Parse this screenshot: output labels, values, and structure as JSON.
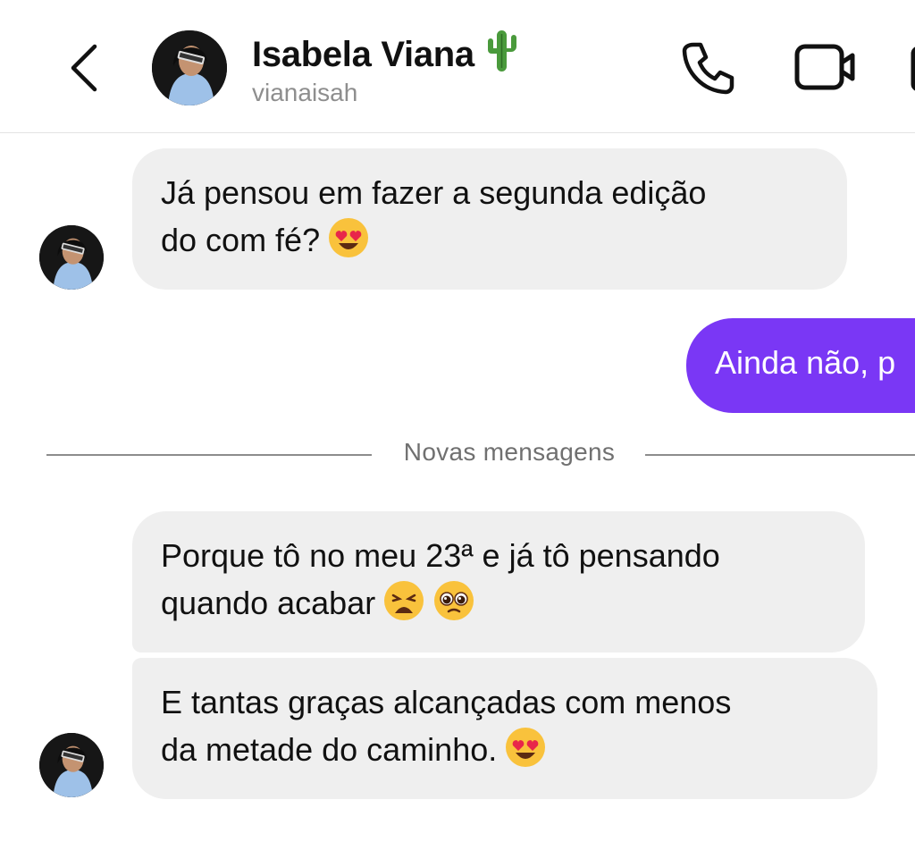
{
  "header": {
    "contact_name": "Isabela Viana",
    "username": "vianaisah",
    "name_emoji": "cactus-icon",
    "back_icon": "chevron-left-icon",
    "call_icon": "phone-icon",
    "video_icon": "video-camera-icon"
  },
  "messages": [
    {
      "direction": "incoming",
      "line1": "Já pensou em fazer a segunda edição",
      "line2": "do com fé?",
      "emoji": [
        "heart-eyes-emoji"
      ]
    },
    {
      "direction": "outgoing",
      "text": "Ainda não, p"
    },
    {
      "direction": "incoming",
      "line1": "Porque tô no meu 23ª e já tô pensando",
      "line2": "quando acabar",
      "emoji": [
        "weary-face-emoji",
        "pleading-face-emoji"
      ]
    },
    {
      "direction": "incoming",
      "line1": "E tantas graças alcançadas com menos",
      "line2": "da metade do caminho.",
      "emoji": [
        "heart-eyes-emoji"
      ]
    }
  ],
  "divider": {
    "label": "Novas mensagens"
  },
  "colors": {
    "outgoing_bubble": "#7a37f5",
    "incoming_bubble": "#efefef",
    "divider_text": "#707070",
    "username_text": "#8e8e8e"
  }
}
